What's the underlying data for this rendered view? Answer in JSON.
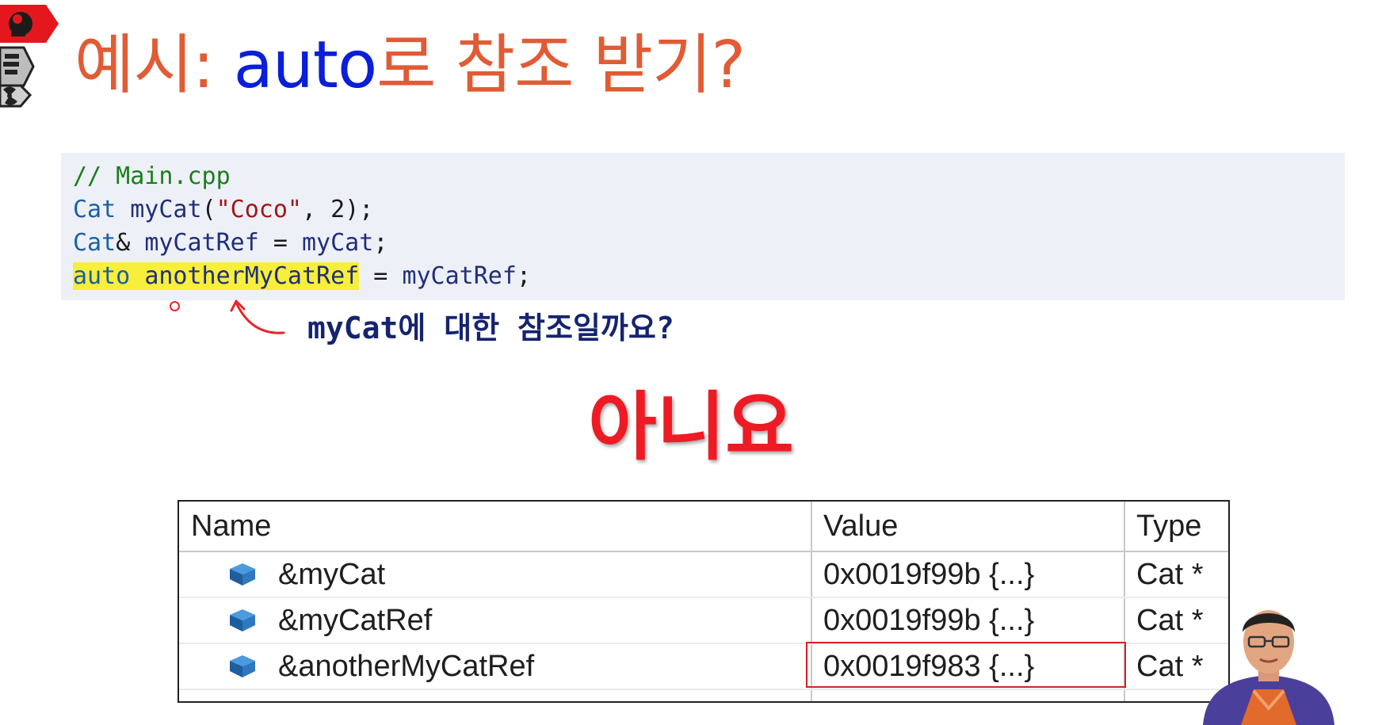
{
  "title": {
    "prefix": "예시: ",
    "keyword": "auto",
    "suffix": "로 참조 받기?"
  },
  "code": {
    "line1": {
      "comment": "// Main.cpp"
    },
    "line2": {
      "type": "Cat",
      "sp1": " ",
      "ident": "myCat",
      "open": "(",
      "str": "\"Coco\"",
      "sep": ", ",
      "num": "2",
      "close": ");"
    },
    "line3": {
      "type": "Cat",
      "amp": "& ",
      "ident": "myCatRef",
      "eq": " = ",
      "ident2": "myCat",
      "end": ";"
    },
    "line4": {
      "kw": "auto",
      "sp": " ",
      "ident": "anotherMyCatRef",
      "eq": " = ",
      "ident2": "myCatRef",
      "end": ";"
    }
  },
  "annotation": "myCat에 대한 참조일까요?",
  "answer": "아니요",
  "watch_table": {
    "headers": {
      "name": "Name",
      "value": "Value",
      "type": "Type"
    },
    "rows": [
      {
        "name": "&myCat",
        "value": "0x0019f99b {...}",
        "type": "Cat *"
      },
      {
        "name": "&myCatRef",
        "value": "0x0019f99b {...}",
        "type": "Cat *"
      },
      {
        "name": "&anotherMyCatRef",
        "value": "0x0019f983 {...}",
        "type": "Cat *"
      }
    ]
  },
  "colors": {
    "title_orange": "#E15B34",
    "title_blue": "#0A1FD8",
    "answer_red": "#EE1B24",
    "highlight_yellow": "#F8EE3C",
    "highlight_box_red": "#D81F26"
  },
  "icons": {
    "corner": [
      "brain-icon",
      "books-icon",
      "radiation-icon"
    ],
    "row_icon": "object-cube-icon"
  }
}
